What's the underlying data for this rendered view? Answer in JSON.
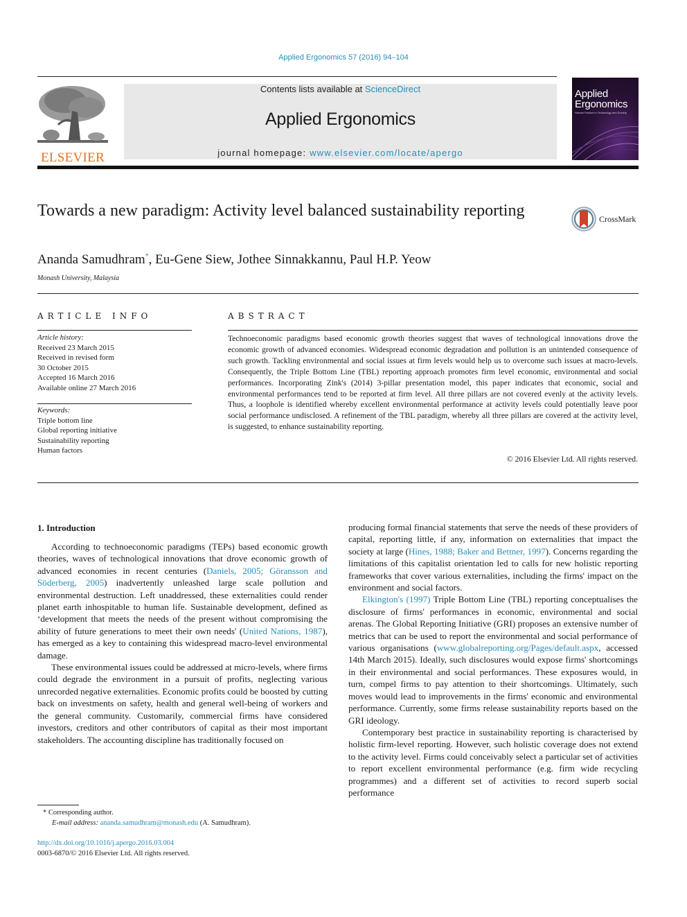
{
  "header": {
    "journal_reference": "Applied Ergonomics 57 (2016) 94–104",
    "contents_prefix": "Contents lists available at ",
    "contents_link": "ScienceDirect",
    "journal_title": "Applied Ergonomics",
    "homepage_prefix": "journal homepage: ",
    "homepage_link": "www.elsevier.com/locate/apergo",
    "publisher_logo_text": "ELSEVIER",
    "cover_title_line1": "Applied",
    "cover_title_line2": "Ergonomics",
    "cover_subtitle": "Human Factors in Technology and Society",
    "colors": {
      "link": "#2a8cb8",
      "elsevier_orange": "#e9711c",
      "masthead_bg": "#e8e8e8"
    }
  },
  "article": {
    "title": "Towards a new paradigm: Activity level balanced sustainability reporting",
    "crossmark_label": "CrossMark",
    "authors": {
      "first": "Ananda Samudhram",
      "first_marker": "*",
      "rest": ", Eu-Gene Siew, Jothee Sinnakkannu, Paul H.P. Yeow"
    },
    "affiliation": "Monash University, Malaysia"
  },
  "article_info": {
    "heading": "ARTICLE INFO",
    "history_label": "Article history:",
    "history": [
      "Received 23 March 2015",
      "Received in revised form",
      "30 October 2015",
      "Accepted 16 March 2016",
      "Available online 27 March 2016"
    ],
    "keywords_label": "Keywords:",
    "keywords": [
      "Triple bottom line",
      "Global reporting initiative",
      "Sustainability reporting",
      "Human factors"
    ]
  },
  "abstract": {
    "heading": "ABSTRACT",
    "text": "Technoeconomic paradigms based economic growth theories suggest that waves of technological innovations drove the economic growth of advanced economies. Widespread economic degradation and pollution is an unintended consequence of such growth. Tackling environmental and social issues at firm levels would help us to overcome such issues at macro-levels. Consequently, the Triple Bottom Line (TBL) reporting approach promotes firm level economic, environmental and social performances. Incorporating Zink's (2014) 3-pillar presentation model, this paper indicates that economic, social and environmental performances tend to be reported at firm level. All three pillars are not covered evenly at the activity levels. Thus, a loophole is identified whereby excellent environmental performance at activity levels could potentially leave poor social performance undisclosed. A refinement of the TBL paradigm, whereby all three pillars are covered at the activity level, is suggested, to enhance sustainability reporting.",
    "copyright": "© 2016 Elsevier Ltd. All rights reserved."
  },
  "body": {
    "section_heading": "1.  Introduction",
    "left": {
      "p1_a": "According to technoeconomic paradigms (TEPs) based economic growth theories, waves of technological innovations that drove economic growth of advanced economies in recent centuries (",
      "p1_cite1": "Daniels, 2005; Göransson and Söderberg, 2005",
      "p1_b": ") inadvertently unleashed large scale pollution and environmental destruction. Left unaddressed, these externalities could render planet earth inhospitable to human life. Sustainable development, defined as ‘development that meets the needs of the present without compromising the ability of future generations to meet their own needs' (",
      "p1_cite2": "United Nations, 1987",
      "p1_c": "), has emerged as a key to containing this widespread macro-level environmental damage.",
      "p2": "These environmental issues could be addressed at micro-levels, where firms could degrade the environment in a pursuit of profits, neglecting various unrecorded negative externalities. Economic profits could be boosted by cutting back on investments on safety, health and general well-being of workers and the general community. Customarily, commercial firms have considered investors, creditors and other contributors of capital as their most important stakeholders. The accounting discipline has traditionally focused on"
    },
    "right": {
      "p1_a": "producing formal financial statements that serve the needs of these providers of capital, reporting little, if any, information on externalities that impact the society at large (",
      "p1_cite": "Hines, 1988; Baker and Bettner, 1997",
      "p1_b": "). Concerns regarding the limitations of this capitalist orientation led to calls for new holistic reporting frameworks that cover various externalities, including the firms' impact on the environment and social factors.",
      "p2_cite": "Elkington's (1997)",
      "p2_a": " Triple Bottom Line (TBL) reporting conceptualises the disclosure of firms' performances in economic, environmental and social arenas. The Global Reporting Initiative (GRI) proposes an extensive number of metrics that can be used to report the environmental and social performance of various organisations (",
      "p2_link": "www.globalreporting.org/Pages/default.aspx",
      "p2_b": ", accessed 14th March 2015). Ideally, such disclosures would expose firms' shortcomings in their environmental and social performances. These exposures would, in turn, compel firms to pay attention to their shortcomings. Ultimately, such moves would lead to improvements in the firms' economic and environmental performance. Currently, some firms release sustainability reports based on the GRI ideology.",
      "p3": "Contemporary best practice in sustainability reporting is characterised by holistic firm-level reporting. However, such holistic coverage does not extend to the activity level. Firms could conceivably select a particular set of activities to report excellent environmental performance (e.g. firm wide recycling programmes) and a different set of activities to record superb social performance"
    }
  },
  "footer": {
    "corresponding_marker": "*",
    "corresponding_text": " Corresponding author.",
    "email_label": "E-mail address:",
    "email": "ananda.samudhram@monash.edu",
    "email_suffix": " (A. Samudhram).",
    "doi": "http://dx.doi.org/10.1016/j.apergo.2016.03.004",
    "issn_line": "0003-6870/© 2016 Elsevier Ltd. All rights reserved."
  }
}
